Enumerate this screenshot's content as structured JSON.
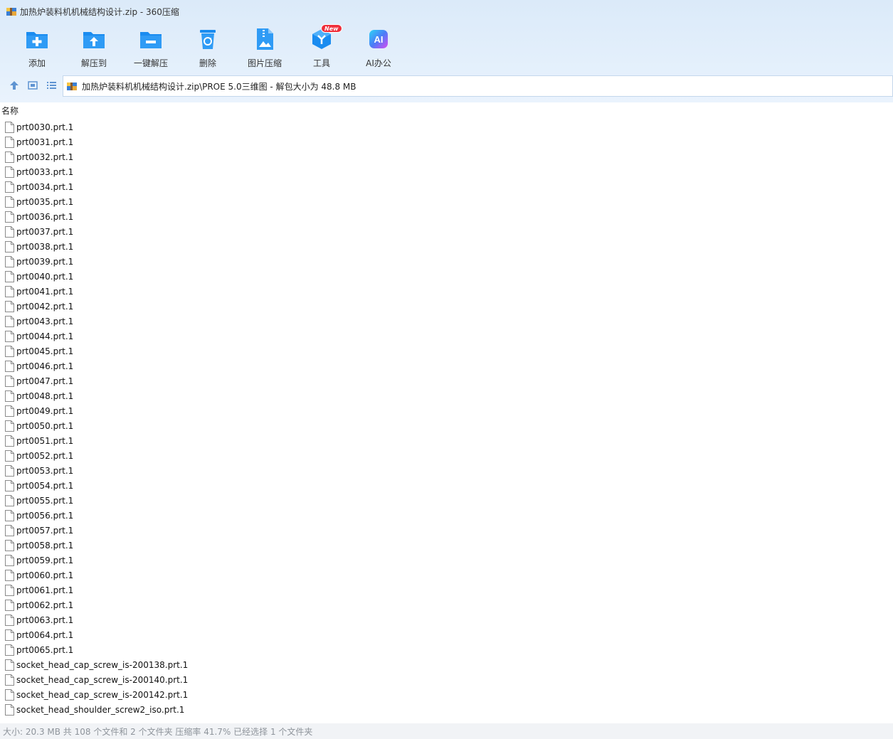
{
  "window": {
    "title": "加热炉装料机机械结构设计.zip - 360压缩"
  },
  "toolbar": {
    "add_label": "添加",
    "extract_to_label": "解压到",
    "one_click_extract_label": "一键解压",
    "delete_label": "删除",
    "image_compress_label": "图片压缩",
    "tools_label": "工具",
    "tools_badge": "New",
    "ai_office_label": "AI办公",
    "ai_icon_text": "AI"
  },
  "address": {
    "path": "加热炉装料机机械结构设计.zip\\PROE 5.0三维图 - 解包大小为 48.8 MB"
  },
  "columns": {
    "name": "名称"
  },
  "files": [
    "prt0030.prt.1",
    "prt0031.prt.1",
    "prt0032.prt.1",
    "prt0033.prt.1",
    "prt0034.prt.1",
    "prt0035.prt.1",
    "prt0036.prt.1",
    "prt0037.prt.1",
    "prt0038.prt.1",
    "prt0039.prt.1",
    "prt0040.prt.1",
    "prt0041.prt.1",
    "prt0042.prt.1",
    "prt0043.prt.1",
    "prt0044.prt.1",
    "prt0045.prt.1",
    "prt0046.prt.1",
    "prt0047.prt.1",
    "prt0048.prt.1",
    "prt0049.prt.1",
    "prt0050.prt.1",
    "prt0051.prt.1",
    "prt0052.prt.1",
    "prt0053.prt.1",
    "prt0054.prt.1",
    "prt0055.prt.1",
    "prt0056.prt.1",
    "prt0057.prt.1",
    "prt0058.prt.1",
    "prt0059.prt.1",
    "prt0060.prt.1",
    "prt0061.prt.1",
    "prt0062.prt.1",
    "prt0063.prt.1",
    "prt0064.prt.1",
    "prt0065.prt.1",
    "socket_head_cap_screw_is-200138.prt.1",
    "socket_head_cap_screw_is-200140.prt.1",
    "socket_head_cap_screw_is-200142.prt.1",
    "socket_head_shoulder_screw2_iso.prt.1"
  ],
  "status": {
    "text": "大小: 20.3 MB 共 108 个文件和 2 个文件夹 压缩率 41.7% 已经选择 1 个文件夹"
  },
  "colors": {
    "accent_blue": "#1a8cf0",
    "badge_red": "#ef2e3a"
  }
}
